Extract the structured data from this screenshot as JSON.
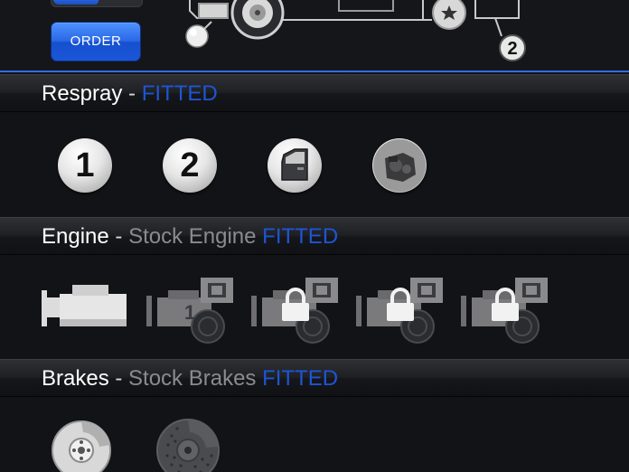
{
  "top": {
    "order_label": "ORDER",
    "diagram_marker": "2"
  },
  "sections": {
    "respray": {
      "title": "Respray",
      "separator": " - ",
      "current": "",
      "status": "FITTED",
      "options": [
        {
          "icon": "number-1-icon",
          "label": "1"
        },
        {
          "icon": "number-2-icon",
          "label": "2"
        },
        {
          "icon": "car-door-icon",
          "label": ""
        },
        {
          "icon": "engine-part-icon",
          "label": ""
        }
      ]
    },
    "engine": {
      "title": "Engine",
      "separator": " - ",
      "current": "Stock Engine",
      "status": "FITTED",
      "options": [
        {
          "icon": "engine-stock-icon",
          "locked": false
        },
        {
          "icon": "engine-upgrade-1-icon",
          "locked": false
        },
        {
          "icon": "engine-upgrade-2-icon",
          "locked": true
        },
        {
          "icon": "engine-upgrade-3-icon",
          "locked": true
        },
        {
          "icon": "engine-upgrade-4-icon",
          "locked": true
        }
      ]
    },
    "brakes": {
      "title": "Brakes",
      "separator": " - ",
      "current": "Stock Brakes",
      "status": "FITTED",
      "options": [
        {
          "icon": "brake-disc-stock-icon",
          "locked": false
        },
        {
          "icon": "brake-disc-sport-icon",
          "locked": false
        }
      ]
    }
  },
  "colors": {
    "accent_blue": "#1d55d6",
    "button_blue": "#2a68e6",
    "background": "#121316"
  }
}
